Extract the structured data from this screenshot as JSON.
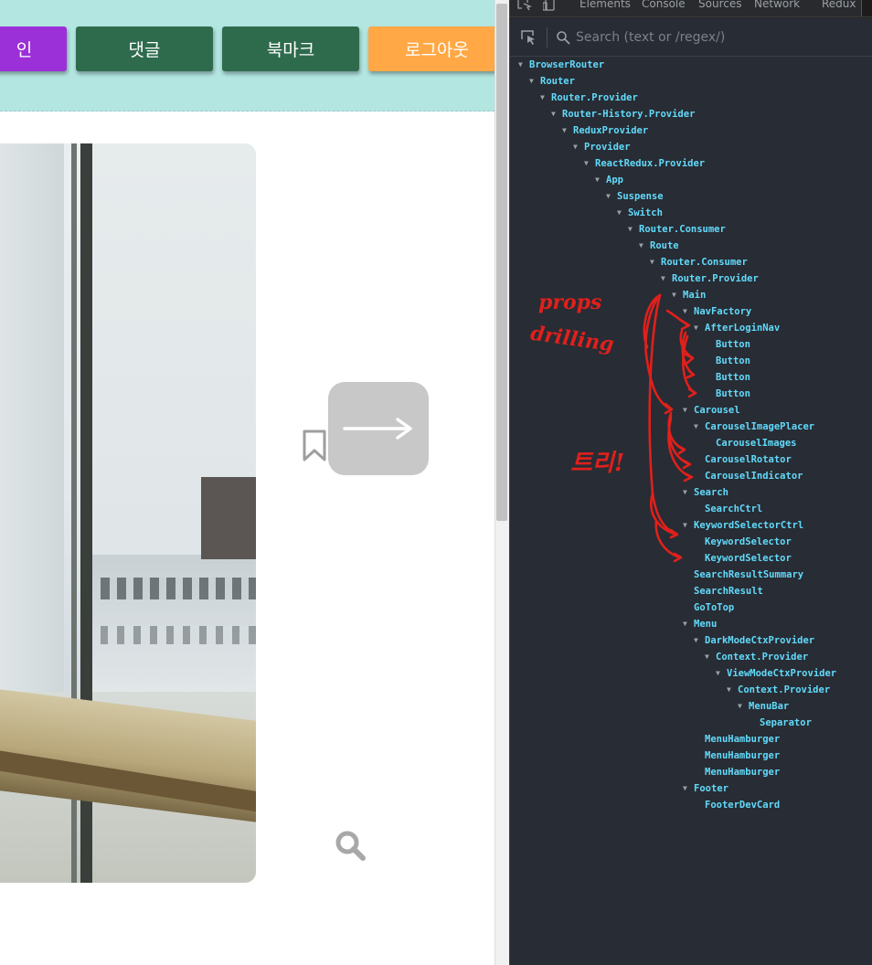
{
  "nav": {
    "login_label": "인",
    "comment_label": "댓글",
    "bookmark_label": "북마크",
    "logout_label": "로그아웃"
  },
  "colors": {
    "nav_bg": "#b3e6e1",
    "login_bg": "#9b30d9",
    "nav_btn_bg": "#2e6b4d",
    "logout_bg": "#ffa845",
    "devtools_bg": "#282c34",
    "tree_text": "#61dafb",
    "annotation": "#e0201c"
  },
  "icons": [
    "bookmark-icon",
    "arrow-right-icon",
    "search-icon",
    "inspect-element-icon",
    "device-toggle-icon",
    "search-glass-icon"
  ],
  "devtools": {
    "tabs": [
      "Elements",
      "Console",
      "Sources",
      "Network",
      "Redux"
    ],
    "search_placeholder": "Search (text or /regex/)",
    "tree": [
      {
        "label": "BrowserRouter",
        "depth": 0,
        "expanded": true
      },
      {
        "label": "Router",
        "depth": 1,
        "expanded": true
      },
      {
        "label": "Router.Provider",
        "depth": 2,
        "expanded": true
      },
      {
        "label": "Router-History.Provider",
        "depth": 3,
        "expanded": true
      },
      {
        "label": "ReduxProvider",
        "depth": 4,
        "expanded": true
      },
      {
        "label": "Provider",
        "depth": 5,
        "expanded": true
      },
      {
        "label": "ReactRedux.Provider",
        "depth": 6,
        "expanded": true
      },
      {
        "label": "App",
        "depth": 7,
        "expanded": true
      },
      {
        "label": "Suspense",
        "depth": 8,
        "expanded": true
      },
      {
        "label": "Switch",
        "depth": 9,
        "expanded": true
      },
      {
        "label": "Router.Consumer",
        "depth": 10,
        "expanded": true
      },
      {
        "label": "Route",
        "depth": 11,
        "expanded": true
      },
      {
        "label": "Router.Consumer",
        "depth": 12,
        "expanded": true
      },
      {
        "label": "Router.Provider",
        "depth": 13,
        "expanded": true
      },
      {
        "label": "Main",
        "depth": 14,
        "expanded": true
      },
      {
        "label": "NavFactory",
        "depth": 15,
        "expanded": true
      },
      {
        "label": "AfterLoginNav",
        "depth": 16,
        "expanded": true
      },
      {
        "label": "Button",
        "depth": 17,
        "expanded": false
      },
      {
        "label": "Button",
        "depth": 17,
        "expanded": false
      },
      {
        "label": "Button",
        "depth": 17,
        "expanded": false
      },
      {
        "label": "Button",
        "depth": 17,
        "expanded": false
      },
      {
        "label": "Carousel",
        "depth": 15,
        "expanded": true
      },
      {
        "label": "CarouselImagePlacer",
        "depth": 16,
        "expanded": true
      },
      {
        "label": "CarouselImages",
        "depth": 17,
        "expanded": false
      },
      {
        "label": "CarouselRotator",
        "depth": 16,
        "expanded": false
      },
      {
        "label": "CarouselIndicator",
        "depth": 16,
        "expanded": false
      },
      {
        "label": "Search",
        "depth": 15,
        "expanded": true
      },
      {
        "label": "SearchCtrl",
        "depth": 16,
        "expanded": false
      },
      {
        "label": "KeywordSelectorCtrl",
        "depth": 15,
        "expanded": true
      },
      {
        "label": "KeywordSelector",
        "depth": 16,
        "expanded": false
      },
      {
        "label": "KeywordSelector",
        "depth": 16,
        "expanded": false
      },
      {
        "label": "SearchResultSummary",
        "depth": 15,
        "expanded": false
      },
      {
        "label": "SearchResult",
        "depth": 15,
        "expanded": false
      },
      {
        "label": "GoToTop",
        "depth": 15,
        "expanded": false
      },
      {
        "label": "Menu",
        "depth": 15,
        "expanded": true
      },
      {
        "label": "DarkModeCtxProvider",
        "depth": 16,
        "expanded": true
      },
      {
        "label": "Context.Provider",
        "depth": 17,
        "expanded": true
      },
      {
        "label": "ViewModeCtxProvider",
        "depth": 18,
        "expanded": true
      },
      {
        "label": "Context.Provider",
        "depth": 19,
        "expanded": true
      },
      {
        "label": "MenuBar",
        "depth": 20,
        "expanded": true
      },
      {
        "label": "Separator",
        "depth": 21,
        "expanded": false
      },
      {
        "label": "MenuHamburger",
        "depth": 16,
        "expanded": false
      },
      {
        "label": "MenuHamburger",
        "depth": 16,
        "expanded": false
      },
      {
        "label": "MenuHamburger",
        "depth": 16,
        "expanded": false
      },
      {
        "label": "Footer",
        "depth": 15,
        "expanded": true
      },
      {
        "label": "FooterDevCard",
        "depth": 16,
        "expanded": false
      }
    ]
  },
  "annotations": {
    "props_line1": "props",
    "props_line2": "drilling",
    "tree_note": "트리!"
  }
}
